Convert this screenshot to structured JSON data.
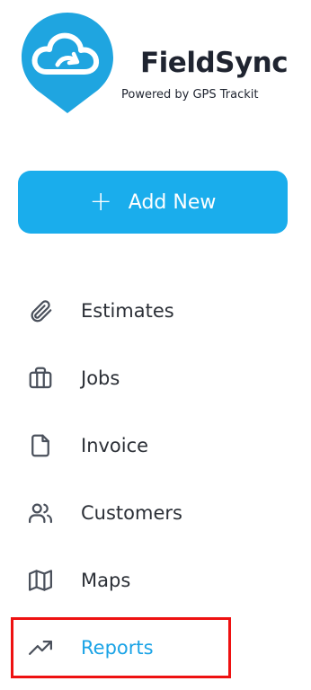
{
  "brand": {
    "name": "FieldSync",
    "tagline": "Powered by GPS Trackit",
    "accent_color": "#1aadec"
  },
  "add_button": {
    "icon": "plus-icon",
    "label": "Add New"
  },
  "nav": {
    "items": [
      {
        "label": "Estimates",
        "icon": "paperclip-icon",
        "active": false
      },
      {
        "label": "Jobs",
        "icon": "briefcase-icon",
        "active": false
      },
      {
        "label": "Invoice",
        "icon": "file-icon",
        "active": false
      },
      {
        "label": "Customers",
        "icon": "users-icon",
        "active": false
      },
      {
        "label": "Maps",
        "icon": "map-icon",
        "active": false
      },
      {
        "label": "Reports",
        "icon": "trending-up-icon",
        "active": true
      }
    ]
  },
  "highlight_color": "#ee1111"
}
